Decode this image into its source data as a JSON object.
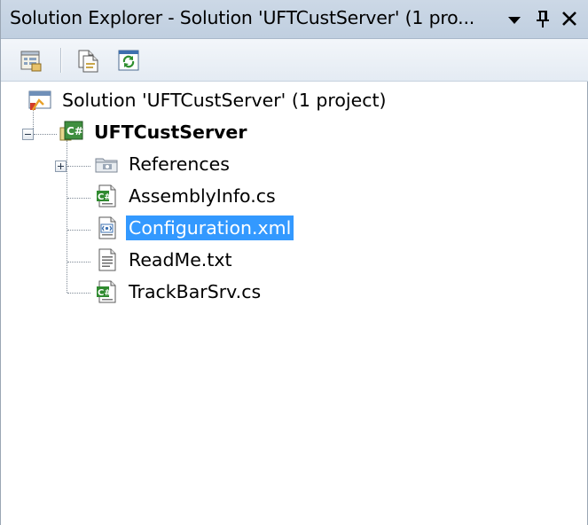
{
  "window": {
    "title": "Solution Explorer - Solution 'UFTCustServer' (1 pro...",
    "dropdown_icon": "window-position-dropdown",
    "pin_glyph": "Й",
    "close_glyph": "✕"
  },
  "toolbar": {
    "items": [
      {
        "name": "properties",
        "icon": "properties-icon"
      },
      {
        "name": "show-all-files",
        "icon": "show-all-files-icon"
      },
      {
        "name": "refresh",
        "icon": "refresh-icon"
      }
    ]
  },
  "tree": {
    "solution": {
      "label": "Solution 'UFTCustServer' (1 project)",
      "icon": "solution-icon"
    },
    "project": {
      "label": "UFTCustServer",
      "icon": "csharp-project-icon",
      "expanded": true
    },
    "children": [
      {
        "label": "References",
        "icon": "references-folder-icon",
        "expandable": true
      },
      {
        "label": "AssemblyInfo.cs",
        "icon": "csharp-file-icon"
      },
      {
        "label": "Configuration.xml",
        "icon": "xml-file-icon",
        "selected": true
      },
      {
        "label": "ReadMe.txt",
        "icon": "text-file-icon"
      },
      {
        "label": "TrackBarSrv.cs",
        "icon": "csharp-file-icon"
      }
    ]
  },
  "colors": {
    "titlebar": "#c5d3e4",
    "selection": "#3399ff",
    "selection_text": "#ffffff"
  }
}
